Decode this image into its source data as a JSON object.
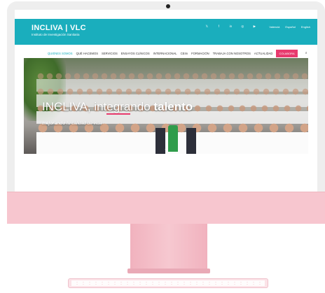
{
  "site": {
    "logo_main": "INCLIVA | VLC",
    "logo_sub": "Instituto de Investigación Sanitaria",
    "social_icons": [
      "x-icon",
      "facebook-icon",
      "linkedin-icon",
      "instagram-icon",
      "youtube-icon"
    ],
    "social_glyphs": [
      "𝕏",
      "f",
      "in",
      "◎",
      "▶"
    ],
    "languages": [
      "Valencià",
      "Español",
      "English"
    ]
  },
  "nav": {
    "items": [
      "QUIÉNES SOMOS",
      "QUÉ HACEMOS",
      "SERVICIOS",
      "ENSAYOS CLÍNICOS",
      "INTERNACIONAL",
      "CEIm",
      "FORMACIÓN",
      "TRABAJA CON NOSOTROS",
      "ACTUALIDAD"
    ],
    "highlight": "COLABORA",
    "search_glyph": "⌕"
  },
  "hero": {
    "title_light": "INCLIVA, integrando",
    "title_bold": "talento",
    "subtitle_bold": "mejorando",
    "subtitle_rest": " tu calidad de vida",
    "scroll_glyph": "⌄"
  },
  "colors": {
    "brand_teal": "#1aaebd",
    "accent_pink": "#e83a6e",
    "device_pink": "#f7c6cf"
  }
}
